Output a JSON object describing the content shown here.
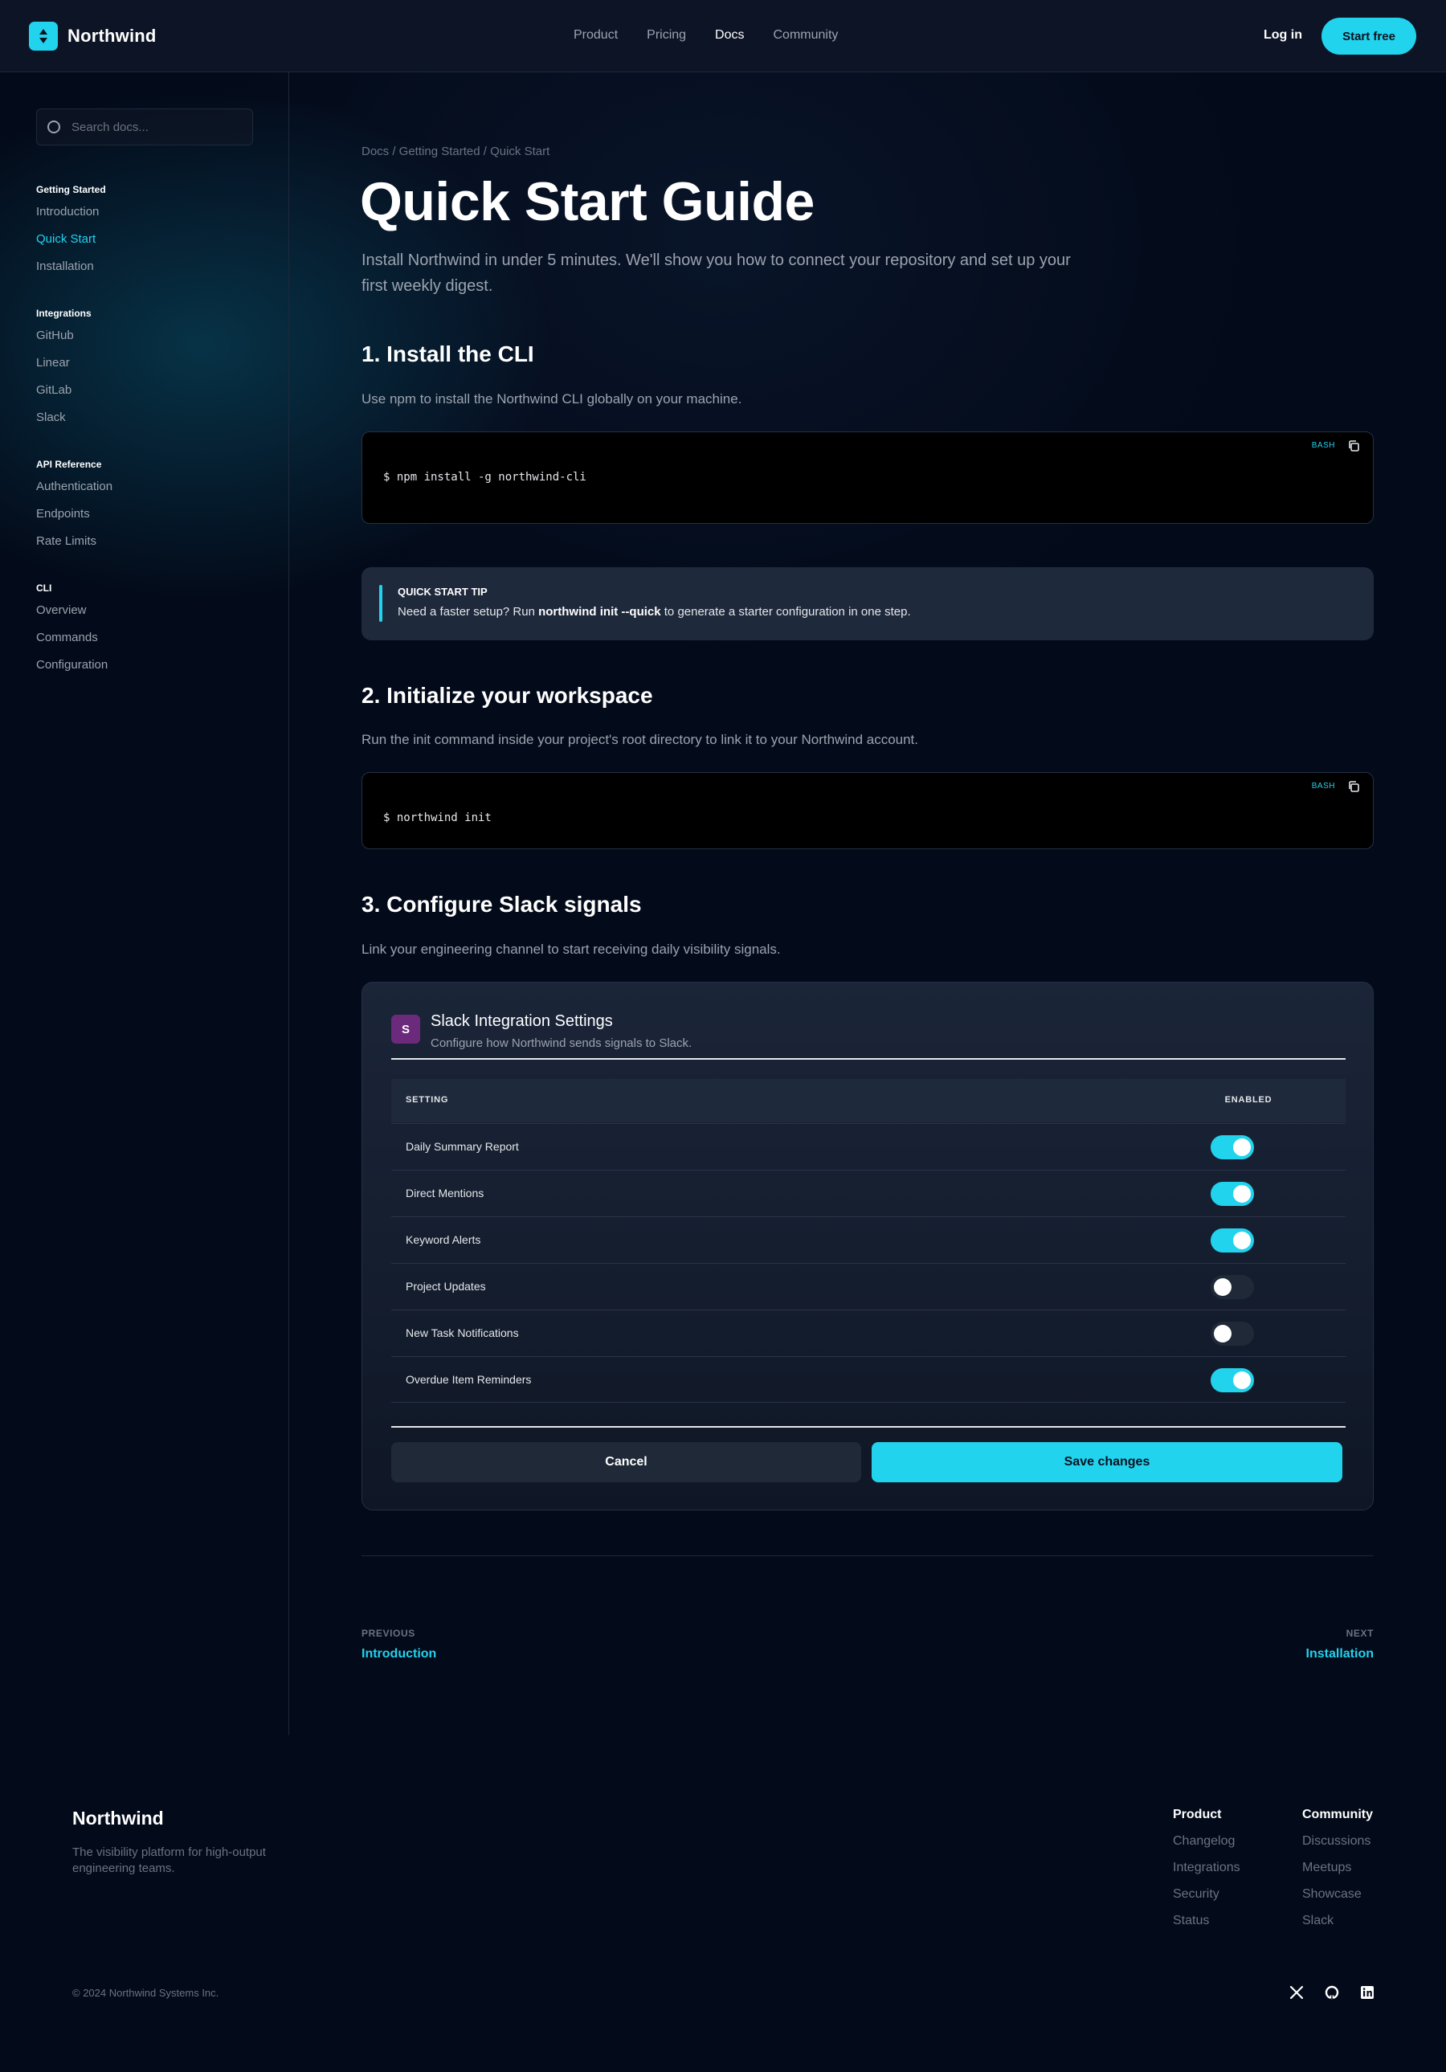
{
  "header": {
    "brand": "Northwind",
    "nav": [
      "Product",
      "Pricing",
      "Docs",
      "Community"
    ],
    "login_label": "Log in",
    "cta_label": "Start free"
  },
  "sidebar": {
    "search_placeholder": "Search docs...",
    "sections": [
      {
        "heading": "Getting Started",
        "items": [
          "Introduction",
          "Quick Start",
          "Installation"
        ]
      },
      {
        "heading": "Integrations",
        "items": [
          "GitHub",
          "Linear",
          "GitLab",
          "Slack"
        ]
      },
      {
        "heading": "API Reference",
        "items": [
          "Authentication",
          "Endpoints",
          "Rate Limits"
        ]
      },
      {
        "heading": "CLI",
        "items": [
          "Overview",
          "Commands",
          "Configuration"
        ]
      }
    ]
  },
  "main": {
    "breadcrumb": "Docs / Getting Started / Quick Start",
    "title": "Quick Start Guide",
    "lead": "Install Northwind in under 5 minutes. We'll show you how to connect your repository and set up your first weekly digest.",
    "step1": {
      "heading": "1. Install the CLI",
      "text": "Use npm to install the Northwind CLI globally on your machine.",
      "code_lang": "BASH",
      "code": "$ npm install -g northwind-cli"
    },
    "tip": {
      "title": "QUICK START TIP",
      "before": "Need a faster setup? Run ",
      "command": "northwind init --quick",
      "after": " to generate a starter configuration in one step."
    },
    "step2": {
      "heading": "2. Initialize your workspace",
      "text": "Run the init command inside your project's root directory to link it to your Northwind account.",
      "code_lang": "BASH",
      "code": "$ northwind init"
    },
    "step3": {
      "heading": "3. Configure Slack signals",
      "text": "Link your engineering channel to start receiving daily visibility signals."
    },
    "slack_card": {
      "icon_letter": "S",
      "title": "Slack Integration Settings",
      "subtitle": "Configure how Northwind sends signals to Slack.",
      "col_setting": "SETTING",
      "col_enabled": "ENABLED",
      "rows": [
        {
          "label": "Daily Summary Report",
          "enabled": true
        },
        {
          "label": "Direct Mentions",
          "enabled": true
        },
        {
          "label": "Keyword Alerts",
          "enabled": true
        },
        {
          "label": "Project Updates",
          "enabled": false
        },
        {
          "label": "New Task Notifications",
          "enabled": false
        },
        {
          "label": "Overdue Item Reminders",
          "enabled": true
        }
      ],
      "cancel_label": "Cancel",
      "save_label": "Save changes"
    },
    "pagination": {
      "prev_label": "PREVIOUS",
      "prev_link": "Introduction",
      "next_label": "NEXT",
      "next_link": "Installation"
    }
  },
  "footer": {
    "brand": "Northwind",
    "tagline": "The visibility platform for high-output engineering teams.",
    "columns": [
      {
        "heading": "Product",
        "items": [
          "Changelog",
          "Integrations",
          "Security",
          "Status"
        ]
      },
      {
        "heading": "Community",
        "items": [
          "Discussions",
          "Meetups",
          "Showcase",
          "Slack"
        ]
      }
    ],
    "copyright": "© 2024 Northwind Systems Inc.",
    "social_icons": [
      "x-icon",
      "github-icon",
      "linkedin-icon"
    ]
  },
  "colors": {
    "accent": "#22d3ee",
    "background": "#030a19",
    "slack_purple": "#6b2a7c"
  }
}
